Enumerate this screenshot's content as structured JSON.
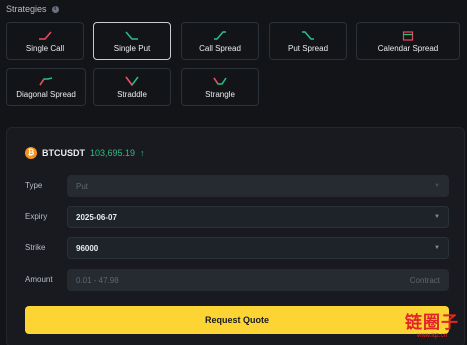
{
  "header": {
    "title": "Strategies"
  },
  "strategies": [
    {
      "label": "Single Call",
      "icon": "single-call-icon"
    },
    {
      "label": "Single Put",
      "icon": "single-put-icon",
      "selected": true
    },
    {
      "label": "Call Spread",
      "icon": "call-spread-icon"
    },
    {
      "label": "Put Spread",
      "icon": "put-spread-icon"
    },
    {
      "label": "Calendar Spread",
      "icon": "calendar-spread-icon"
    },
    {
      "label": "Diagonal Spread",
      "icon": "diagonal-spread-icon"
    },
    {
      "label": "Straddle",
      "icon": "straddle-icon"
    },
    {
      "label": "Strangle",
      "icon": "strangle-icon"
    }
  ],
  "colors": {
    "up": "#2ebd85",
    "down": "#f6465d",
    "accent": "#fcd535",
    "btc": "#f7931a"
  },
  "ticker": {
    "symbol": "BTCUSDT",
    "price": "103,695.19",
    "arrow": "↑",
    "coin_glyph": "₿"
  },
  "form": {
    "type": {
      "label": "Type",
      "value": "Put"
    },
    "expiry": {
      "label": "Expiry",
      "value": "2025-06-07"
    },
    "strike": {
      "label": "Strike",
      "value": "96000"
    },
    "amount": {
      "label": "Amount",
      "placeholder": "0.01 - 47.98",
      "unit": "Contract"
    }
  },
  "submit": {
    "label": "Request Quote"
  },
  "watermark": {
    "text": "链圈子",
    "sub": "www.lqz.cn"
  }
}
